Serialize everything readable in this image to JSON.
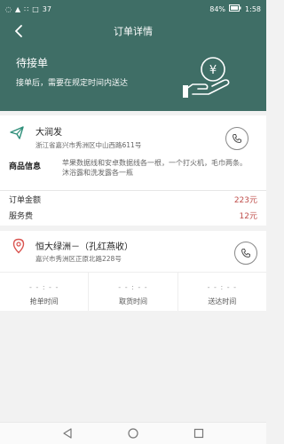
{
  "status_bar": {
    "left": [
      "◌",
      "▲",
      "∷",
      "□",
      "37"
    ],
    "right": [
      "84%",
      "1:58"
    ]
  },
  "header": {
    "title": "订单详情"
  },
  "hero": {
    "status": "待接单",
    "note": "接单后，需要在规定时间内送达"
  },
  "pickup": {
    "name": "大润发",
    "address": "浙江省嘉兴市秀洲区中山西路611号",
    "goods_label": "商品信息",
    "goods_desc": "苹果数据线和安卓数据线各一根，一个打火机，毛巾两条。沐浴露和洗发露各一瓶",
    "amount_label": "订单金额",
    "amount_value": "223元",
    "fee_label": "服务费",
    "fee_value": "12元"
  },
  "delivery": {
    "name": "恒大绿洲－（孔红燕收）",
    "address": "嘉兴市秀洲区正原北路228号"
  },
  "times": [
    {
      "value": "- - : - -",
      "label": "抢单时间"
    },
    {
      "value": "- - : - -",
      "label": "取货时间"
    },
    {
      "value": "- - : - -",
      "label": "送达时间"
    }
  ],
  "colors": {
    "theme": "#3f6e66",
    "accent_red": "#c0504d",
    "background": "#f2f2f2"
  }
}
